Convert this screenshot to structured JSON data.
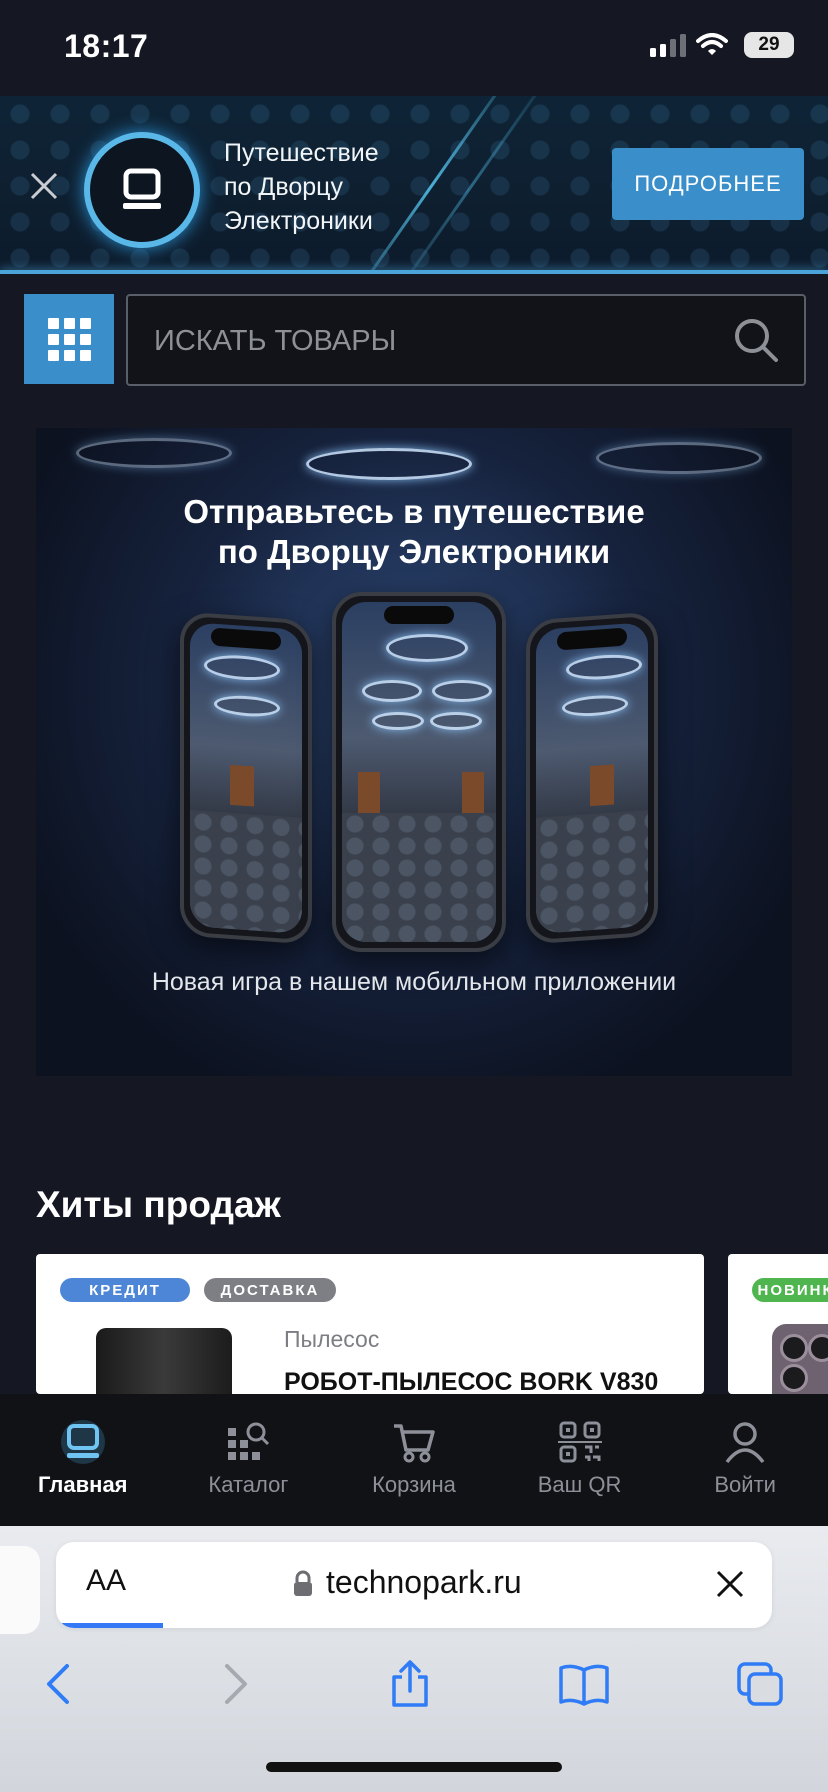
{
  "status_bar": {
    "time": "18:17",
    "battery": "29"
  },
  "promo": {
    "lines": [
      "Путешествие",
      "по Дворцу",
      "Электроники"
    ],
    "button_label": "ПОДРОБНЕЕ"
  },
  "search": {
    "placeholder": "ИСКАТЬ ТОВАРЫ"
  },
  "hero": {
    "title_line1": "Отправьтесь в путешествие",
    "title_line2": "по Дворцу Электроники",
    "subtitle": "Новая игра в нашем мобильном приложении"
  },
  "hits": {
    "title": "Хиты продаж",
    "products": [
      {
        "badges": [
          "КРЕДИТ",
          "ДОСТАВКА"
        ],
        "category": "Пылесос",
        "name": "РОБОТ-ПЫЛЕСОС BORK V830"
      },
      {
        "badges": [
          "НОВИНКА"
        ]
      }
    ]
  },
  "tabbar": {
    "items": [
      {
        "label": "Главная",
        "icon": "home-monitor-icon",
        "active": true
      },
      {
        "label": "Каталог",
        "icon": "catalog-search-icon"
      },
      {
        "label": "Корзина",
        "icon": "cart-icon"
      },
      {
        "label": "Ваш QR",
        "icon": "qr-icon"
      },
      {
        "label": "Войти",
        "icon": "user-icon"
      }
    ]
  },
  "browser": {
    "text_size_label": "AA",
    "url": "technopark.ru",
    "page_load_progress": 0.15
  },
  "colors": {
    "accent": "#3a8ec9",
    "credit_badge": "#4d86d6",
    "delivery_badge": "#7d7f84",
    "new_badge": "#4fb64f",
    "background": "#151822"
  }
}
